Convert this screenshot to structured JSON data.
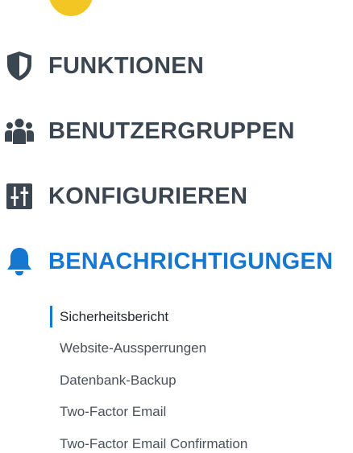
{
  "colors": {
    "accent": "#1577d0",
    "nav_text": "#3c4650",
    "sub_text": "#4a5158",
    "active_sub_text": "#222831",
    "top_badge": "#f3c623"
  },
  "nav": {
    "items": [
      {
        "label": "FUNKTIONEN",
        "icon": "shield-icon"
      },
      {
        "label": "BENUTZERGRUPPEN",
        "icon": "users-icon"
      },
      {
        "label": "KONFIGURIEREN",
        "icon": "settings-sliders-icon"
      },
      {
        "label": "BENACHRICHTIGUNGEN",
        "icon": "bell-icon",
        "active": true
      }
    ]
  },
  "submenu": {
    "items": [
      {
        "label": "Sicherheitsbericht",
        "active": true
      },
      {
        "label": "Website-Aussperrungen"
      },
      {
        "label": "Datenbank-Backup"
      },
      {
        "label": "Two-Factor Email"
      },
      {
        "label": "Two-Factor Email Confirmation"
      }
    ]
  }
}
